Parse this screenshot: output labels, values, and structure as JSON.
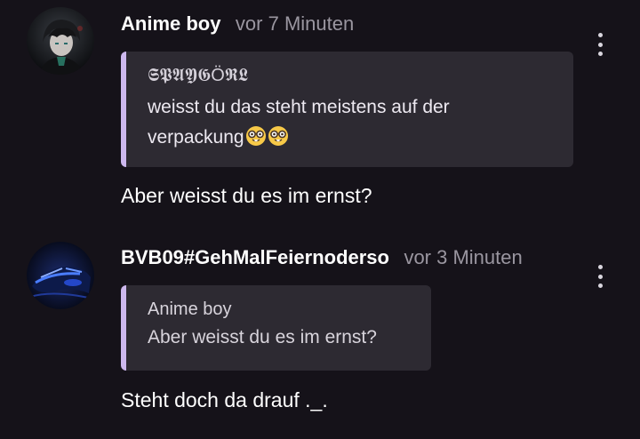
{
  "comments": [
    {
      "author": "Anime boy",
      "time": "vor 7 Minuten",
      "quote": {
        "author": "𝕾𝕻𝕬𝖄𝕲Ö𝕽𝕷",
        "line1": "weisst du das steht meistens auf der",
        "line2": "verpackung",
        "emojis": [
          "nerd-face-emoji",
          "nerd-face-emoji"
        ]
      },
      "text": "Aber weisst du es im ernst?",
      "avatar_icon": "anime-boy-avatar"
    },
    {
      "author": "BVB09#GehMalFeiernoderso",
      "time": "vor 3 Minuten",
      "quote": {
        "author": "Anime boy",
        "line1": "Aber weisst du es im ernst?"
      },
      "text": "Steht doch da drauf ._.",
      "avatar_icon": "blue-light-avatar"
    }
  ],
  "colors": {
    "background": "#151219",
    "quote_background": "#2d2a32",
    "quote_accent": "#cdb8ee",
    "timestamp": "#9a96a0"
  },
  "icons": {
    "more": "more-vertical-icon"
  }
}
